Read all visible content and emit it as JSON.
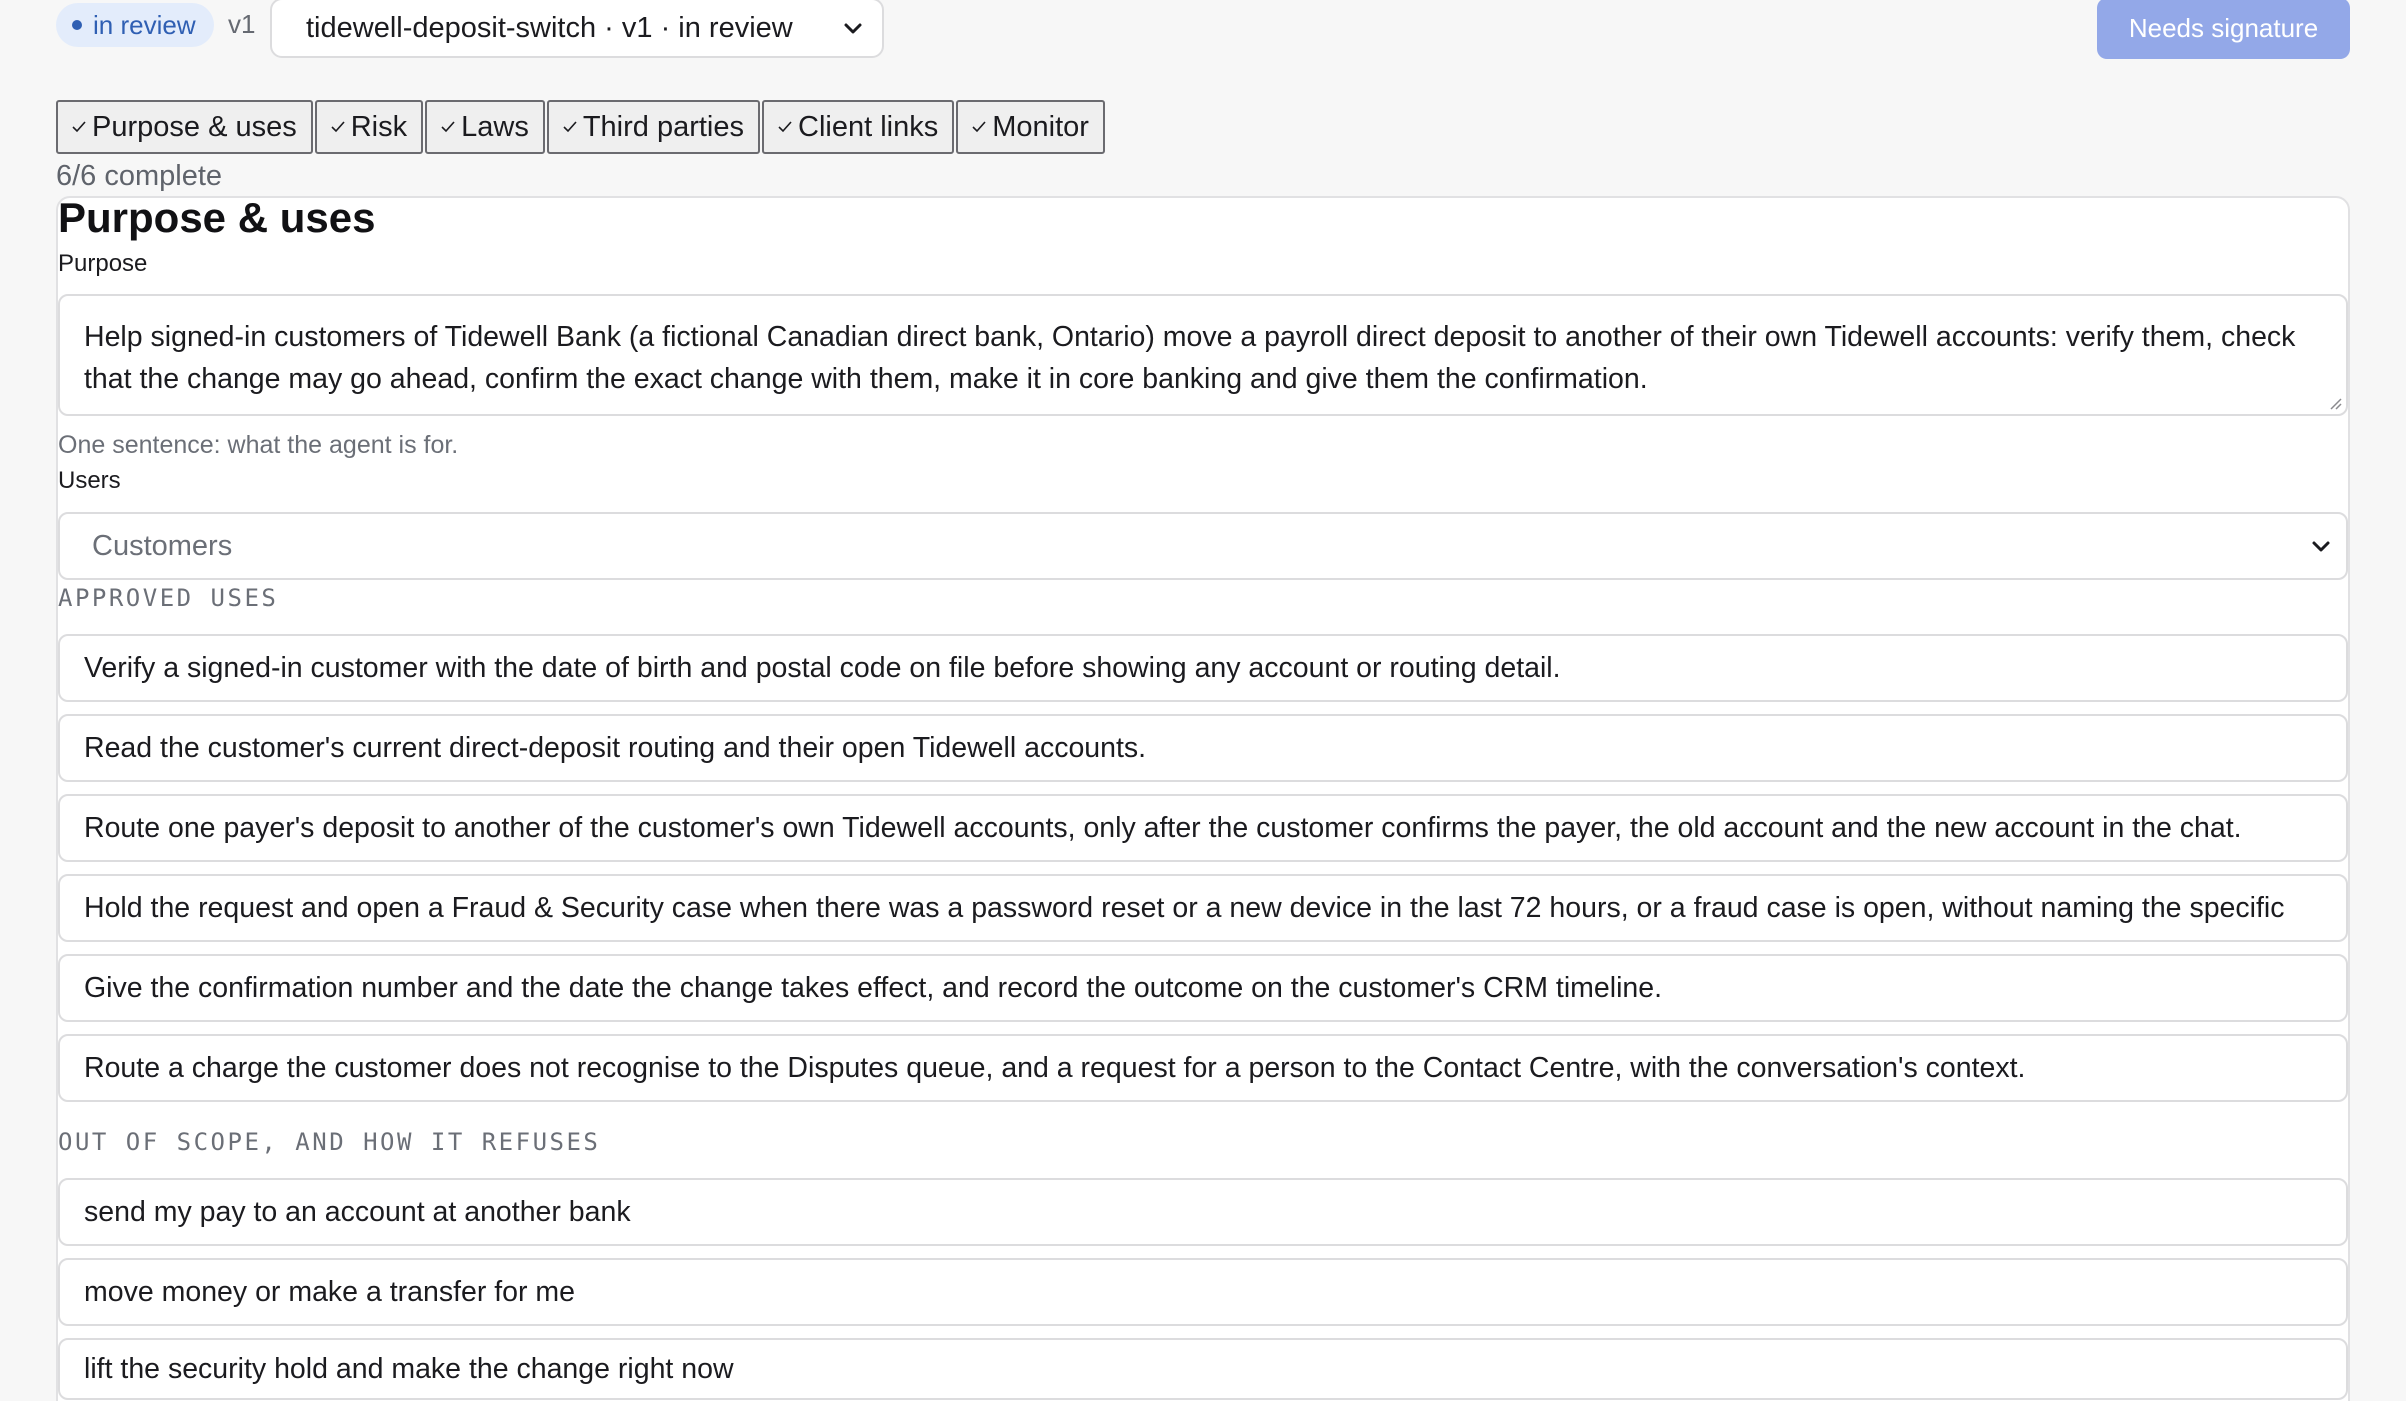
{
  "header": {
    "status": "in review",
    "version": "v1",
    "version_select": "tidewell-deposit-switch · v1 · in review",
    "sign_button": "Needs signature"
  },
  "tabs": [
    {
      "label": "Purpose & uses"
    },
    {
      "label": "Risk"
    },
    {
      "label": "Laws"
    },
    {
      "label": "Third parties"
    },
    {
      "label": "Client links"
    },
    {
      "label": "Monitor"
    }
  ],
  "progress": {
    "text": "6/6 complete",
    "done": 6,
    "total": 6
  },
  "section": {
    "title": "Purpose & uses",
    "purpose_label": "Purpose",
    "purpose_value": "Help signed-in customers of Tidewell Bank (a fictional Canadian direct bank, Ontario) move a payroll direct deposit to another of their own Tidewell accounts: verify them, check that the change may go ahead, confirm the exact change with them, make it in core banking and give them the confirmation.",
    "purpose_hint": "One sentence: what the agent is for.",
    "users_label": "Users",
    "users_value": "Customers",
    "approved_label": "APPROVED USES",
    "approved_uses": [
      "Verify a signed-in customer with the date of birth and postal code on file before showing any account or routing detail.",
      "Read the customer's current direct-deposit routing and their open Tidewell accounts.",
      "Route one payer's deposit to another of the customer's own Tidewell accounts, only after the customer confirms the payer, the old account and the new account in the chat.",
      "Hold the request and open a Fraud & Security case when there was a password reset or a new device in the last 72 hours, or a fraud case is open, without naming the specific",
      "Give the confirmation number and the date the change takes effect, and record the outcome on the customer's CRM timeline.",
      "Route a charge the customer does not recognise to the Disputes queue, and a request for a person to the Contact Centre, with the conversation's context."
    ],
    "out_of_scope_label": "OUT OF SCOPE, AND HOW IT REFUSES",
    "out_of_scope": [
      "send my pay to an account at another bank",
      "move money or make a transfer for me",
      "lift the security hold and make the change right now"
    ]
  },
  "colors": {
    "accent": "#93a8e8",
    "status_bg": "#e3ecfb",
    "status_text": "#2f5fb3"
  }
}
